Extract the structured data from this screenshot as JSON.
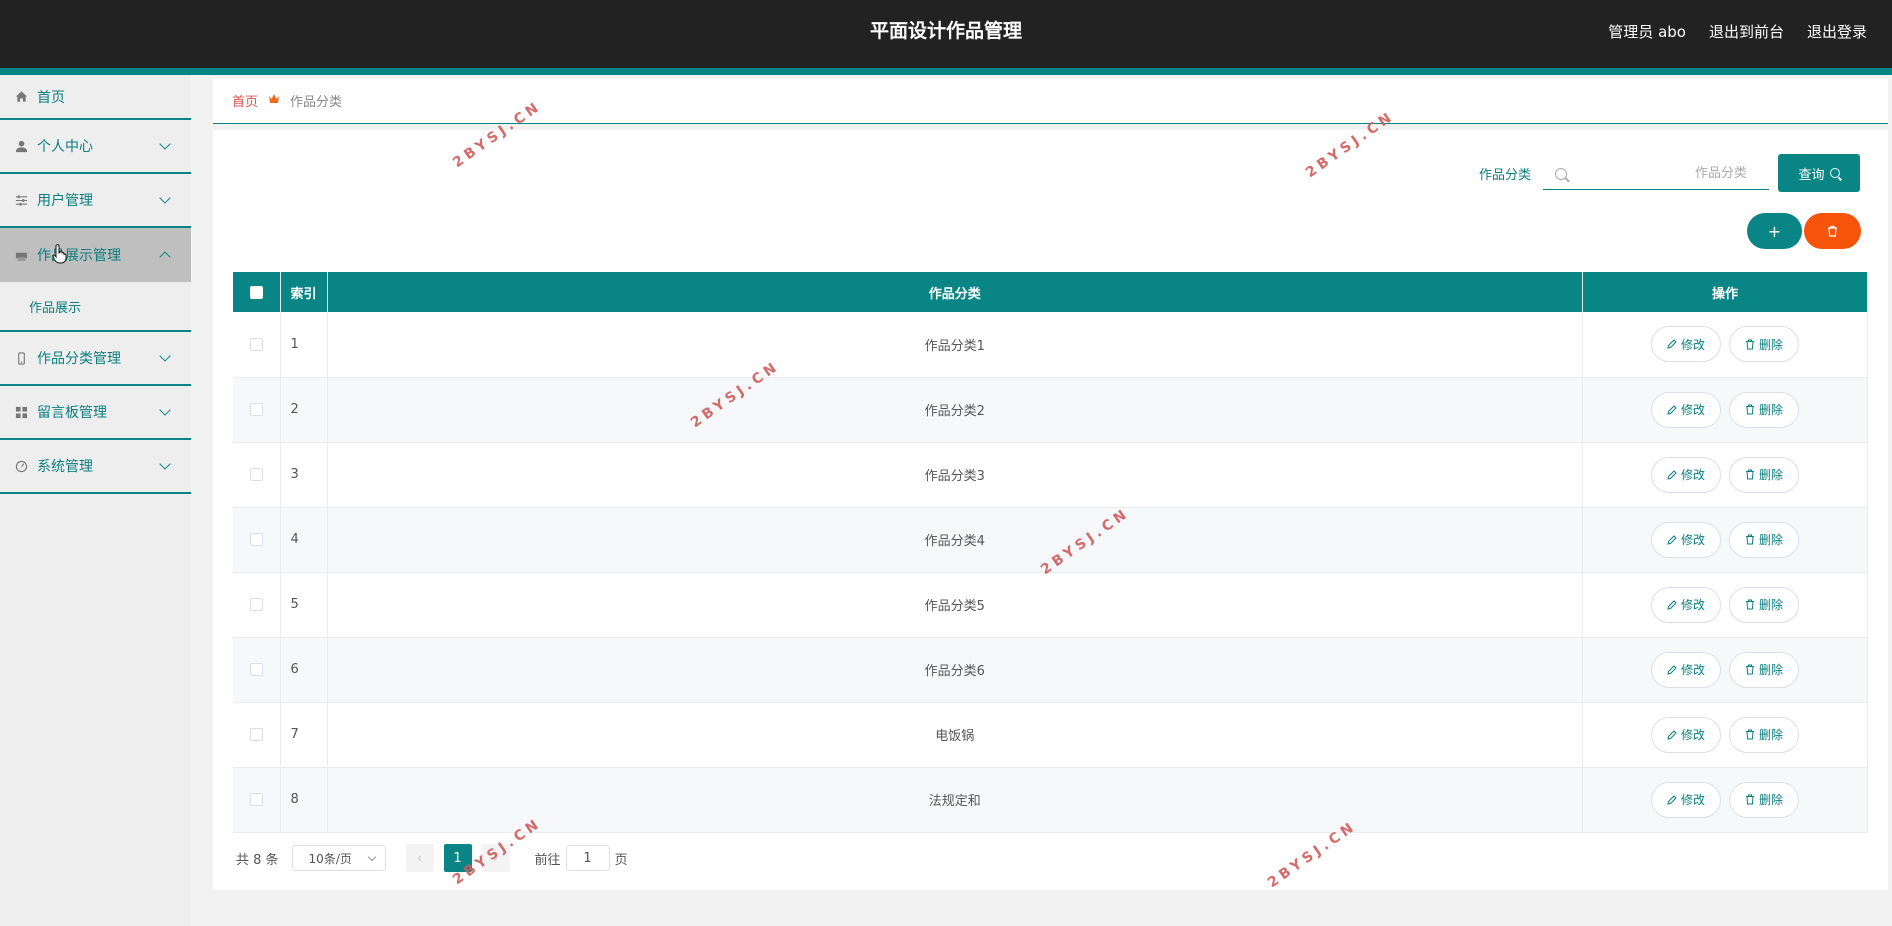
{
  "header": {
    "title": "平面设计作品管理",
    "user": "管理员 abo",
    "to_front": "退出到前台",
    "logout": "退出登录"
  },
  "sidebar": {
    "items": [
      {
        "label": "首页",
        "icon": "home-icon"
      },
      {
        "label": "个人中心",
        "icon": "user-icon"
      },
      {
        "label": "用户管理",
        "icon": "sliders-icon"
      },
      {
        "label": "作品展示管理",
        "icon": "printer-icon",
        "sub": "作品展示"
      },
      {
        "label": "作品分类管理",
        "icon": "phone-icon"
      },
      {
        "label": "留言板管理",
        "icon": "grid-icon"
      },
      {
        "label": "系统管理",
        "icon": "gauge-icon"
      }
    ]
  },
  "breadcrumb": {
    "home": "首页",
    "current": "作品分类"
  },
  "search": {
    "label": "作品分类",
    "placeholder": "作品分类",
    "button": "查询"
  },
  "table": {
    "headers": {
      "index": "索引",
      "name": "作品分类",
      "ops": "操作"
    },
    "edit_label": "修改",
    "delete_label": "删除",
    "rows": [
      {
        "index": "1",
        "name": "作品分类1"
      },
      {
        "index": "2",
        "name": "作品分类2"
      },
      {
        "index": "3",
        "name": "作品分类3"
      },
      {
        "index": "4",
        "name": "作品分类4"
      },
      {
        "index": "5",
        "name": "作品分类5"
      },
      {
        "index": "6",
        "name": "作品分类6"
      },
      {
        "index": "7",
        "name": "电饭锅"
      },
      {
        "index": "8",
        "name": "法规定和"
      }
    ]
  },
  "pagination": {
    "total": "共 8 条",
    "page_size": "10条/页",
    "current_page": "1",
    "goto_prefix": "前往",
    "goto_value": "1",
    "goto_suffix": "页"
  },
  "watermark": "2BYSJ.CN",
  "colors": {
    "accent": "#0a8585",
    "danger": "#f5540a",
    "header_bg": "#222222"
  }
}
